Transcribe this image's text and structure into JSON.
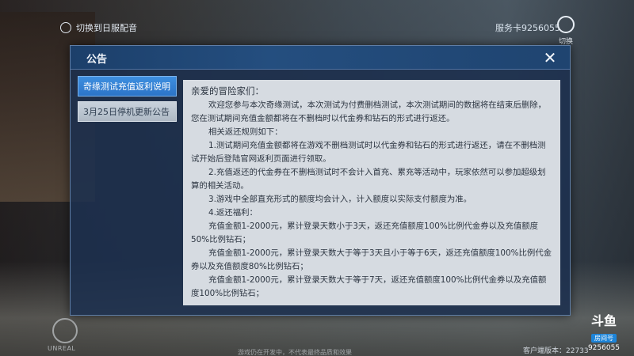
{
  "top": {
    "switch_server": "切换到日服配音",
    "server_label": "服务卡9256055",
    "switch_label": "切换"
  },
  "dialog": {
    "title": "公告",
    "close_glyph": "✕",
    "tabs": [
      {
        "label": "奇缘测试充值返利说明",
        "active": true
      },
      {
        "label": "3月25日停机更新公告",
        "active": false
      }
    ],
    "content": {
      "greeting": "亲爱的冒险家们：",
      "paragraphs": [
        "欢迎您参与本次奇缘测试，本次测试为付费删档测试，本次测试期间的数据将在结束后删除，您在测试期间充值金额都将在不删档时以代金券和钻石的形式进行返还。",
        "相关返还规则如下：",
        "1.测试期间充值金额都将在游戏不删档测试时以代金券和钻石的形式进行返还，请在不删档测试开始后登陆官网返利页面进行领取。",
        "2.充值返还的代金券在不删档测试时不会计入首充、累充等活动中，玩家依然可以参加超级划算的相关活动。",
        "3.游戏中全部直充形式的额度均会计入，计入额度以实际支付额度为准。",
        "4.返还福利：",
        "充值金额1-2000元，累计登录天数小于3天，返还充值额度100%比例代金券以及充值额度50%比例钻石；",
        "充值金额1-2000元，累计登录天数大于等于3天且小于等于6天，返还充值额度100%比例代金券以及充值额度80%比例钻石；",
        "充值金额1-2000元，累计登录天数大于等于7天，返还充值额度100%比例代金券以及充值额度100%比例钻石；"
      ]
    }
  },
  "footer": {
    "engine_label": "UNREAL",
    "version": "客户端版本：22733",
    "notice": "游戏仍在开发中，不代表最终品质和效果"
  },
  "room": {
    "logo": "斗鱼",
    "tag": "房间号",
    "number": "9256055"
  },
  "colors": {
    "accent": "#2c74c7",
    "dialog_bg": "#1c3050",
    "content_bg": "#d6dbe1"
  }
}
